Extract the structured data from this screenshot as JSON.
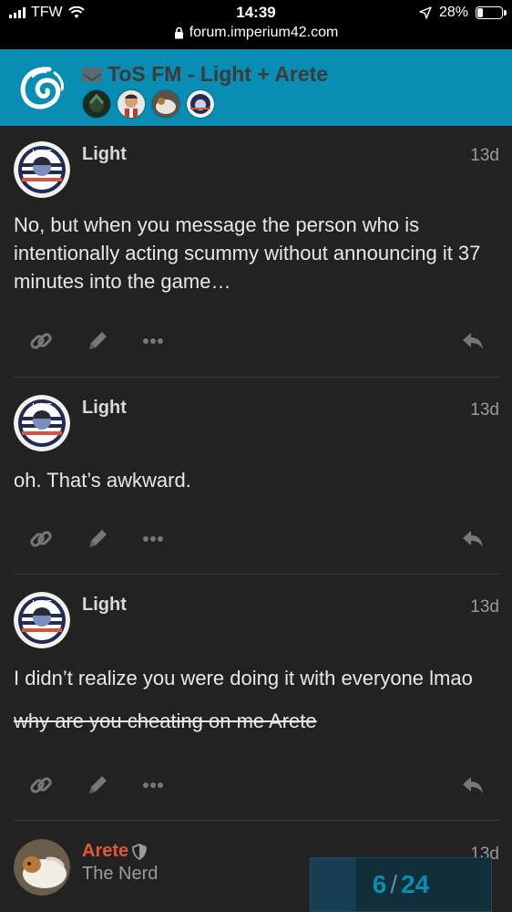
{
  "status_bar": {
    "carrier": "TFW",
    "time": "14:39",
    "url": "forum.imperium42.com",
    "battery_percent": "28%",
    "battery_level": 0.28
  },
  "header": {
    "topic_title": "ToS FM - Light + Arete"
  },
  "posts": [
    {
      "username": "Light",
      "date": "13d",
      "paragraphs": [
        "No, but when you message the person who is intentionally acting scummy without announcing it 37 minutes into the game…"
      ]
    },
    {
      "username": "Light",
      "date": "13d",
      "paragraphs": [
        "oh. That’s awkward."
      ]
    },
    {
      "username": "Light",
      "date": "13d",
      "paragraphs": [
        "I didn’t realize you were doing it with everyone lmao"
      ],
      "struck": "why are you cheating on me Arete"
    },
    {
      "username": "Arete",
      "date": "13d",
      "user_title": "The Nerd"
    }
  ],
  "progress": {
    "current": "6",
    "total": "24",
    "fraction": 0.25
  },
  "icons": {
    "link": "link-icon",
    "edit": "pencil-icon",
    "more": "more-icon",
    "reply": "reply-icon",
    "lock": "lock-icon",
    "location": "location-arrow-icon",
    "wifi": "wifi-icon",
    "moderator": "shield-icon",
    "private_message": "envelope-icon"
  },
  "colors": {
    "header_bg": "#0a8db3",
    "page_bg": "#222222",
    "accent_username": "#e45735",
    "progress_text": "#0a8db3"
  }
}
